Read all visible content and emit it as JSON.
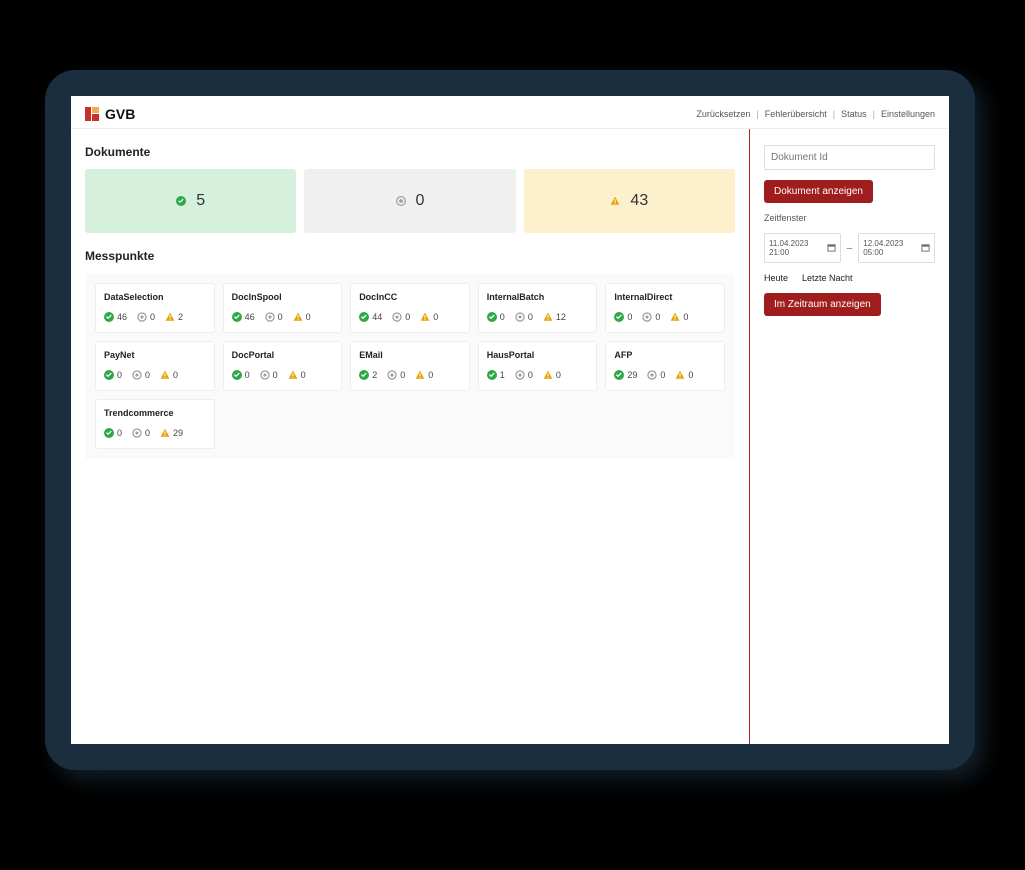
{
  "brand": {
    "name": "GVB"
  },
  "top_links": {
    "reset": "Zurücksetzen",
    "errors": "Fehlerübersicht",
    "status": "Status",
    "settings": "Einstellungen"
  },
  "sections": {
    "documents": "Dokumente",
    "messpunkte": "Messpunkte"
  },
  "summary": {
    "success": "5",
    "neutral": "0",
    "warn": "43"
  },
  "messpunkte": [
    {
      "name": "DataSelection",
      "ok": "46",
      "neutral": "0",
      "warn": "2"
    },
    {
      "name": "DocInSpool",
      "ok": "46",
      "neutral": "0",
      "warn": "0"
    },
    {
      "name": "DocInCC",
      "ok": "44",
      "neutral": "0",
      "warn": "0"
    },
    {
      "name": "InternalBatch",
      "ok": "0",
      "neutral": "0",
      "warn": "12"
    },
    {
      "name": "InternalDirect",
      "ok": "0",
      "neutral": "0",
      "warn": "0"
    },
    {
      "name": "PayNet",
      "ok": "0",
      "neutral": "0",
      "warn": "0"
    },
    {
      "name": "DocPortal",
      "ok": "0",
      "neutral": "0",
      "warn": "0"
    },
    {
      "name": "EMail",
      "ok": "2",
      "neutral": "0",
      "warn": "0"
    },
    {
      "name": "HausPortal",
      "ok": "1",
      "neutral": "0",
      "warn": "0"
    },
    {
      "name": "AFP",
      "ok": "29",
      "neutral": "0",
      "warn": "0"
    },
    {
      "name": "Trendcommerce",
      "ok": "0",
      "neutral": "0",
      "warn": "29"
    }
  ],
  "side": {
    "doc_id_placeholder": "Dokument Id",
    "show_doc": "Dokument anzeigen",
    "timeframe_label": "Zeitfenster",
    "from": "11.04.2023 21:00",
    "to": "12.04.2023 05:00",
    "today": "Heute",
    "last_night": "Letzte Nacht",
    "show_range": "Im Zeitraum anzeigen"
  }
}
